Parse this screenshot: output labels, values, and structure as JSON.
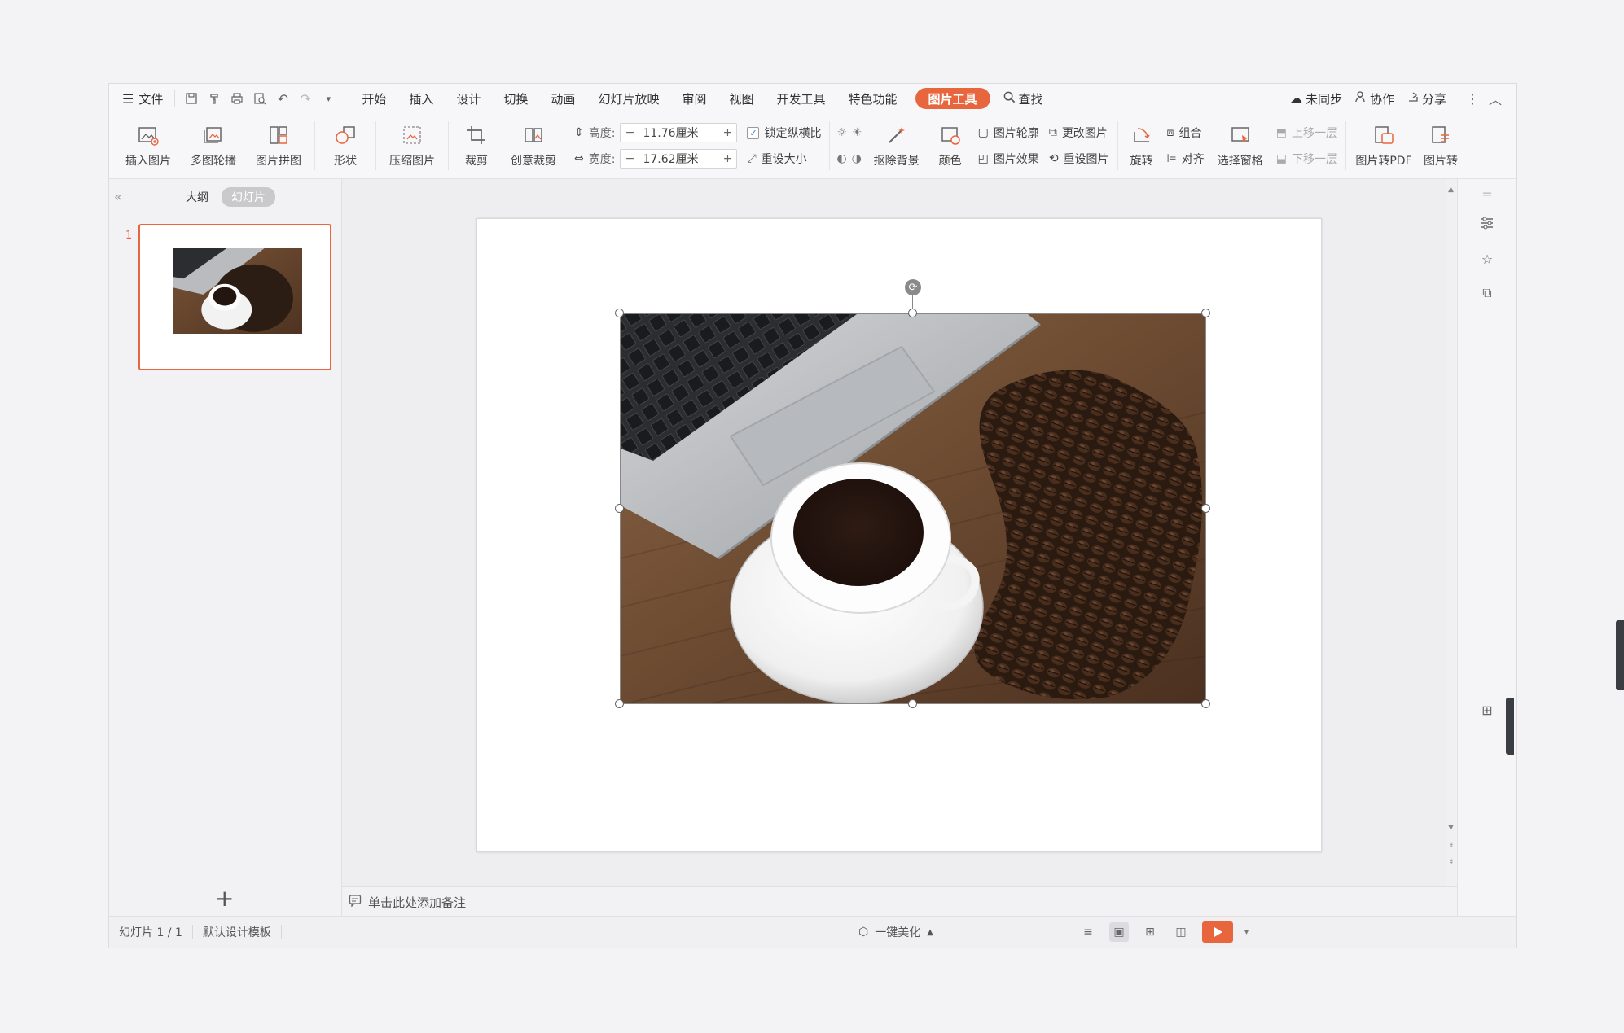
{
  "menu": {
    "file": "文件",
    "tabs": [
      "开始",
      "插入",
      "设计",
      "切换",
      "动画",
      "幻灯片放映",
      "审阅",
      "视图",
      "开发工具",
      "特色功能"
    ],
    "active_tab": "图片工具",
    "search": "查找",
    "sync": "未同步",
    "collab": "协作",
    "share": "分享"
  },
  "ribbon": {
    "insert_picture": "插入图片",
    "multi_carousel": "多图轮播",
    "collage": "图片拼图",
    "shape": "形状",
    "compress": "压缩图片",
    "crop": "裁剪",
    "creative_crop": "创意裁剪",
    "height_label": "高度:",
    "height_value": "11.76厘米",
    "width_label": "宽度:",
    "width_value": "17.62厘米",
    "lock_ratio": "锁定纵横比",
    "reset_size": "重设大小",
    "remove_bg": "抠除背景",
    "color": "颜色",
    "outline": "图片轮廓",
    "effect": "图片效果",
    "change_picture": "更改图片",
    "reset_picture": "重设图片",
    "rotate": "旋转",
    "group": "组合",
    "align": "对齐",
    "selection_pane": "选择窗格",
    "bring_forward": "上移一层",
    "send_backward": "下移一层",
    "to_pdf": "图片转PDF",
    "to_text": "图片转"
  },
  "leftpanel": {
    "outline_tab": "大纲",
    "slides_tab": "幻灯片",
    "slide_number": "1"
  },
  "notes": {
    "placeholder": "单击此处添加备注"
  },
  "status": {
    "slide_count": "幻灯片 1 / 1",
    "template": "默认设计模板",
    "beautify": "一键美化"
  },
  "colors": {
    "accent": "#e8663e"
  }
}
